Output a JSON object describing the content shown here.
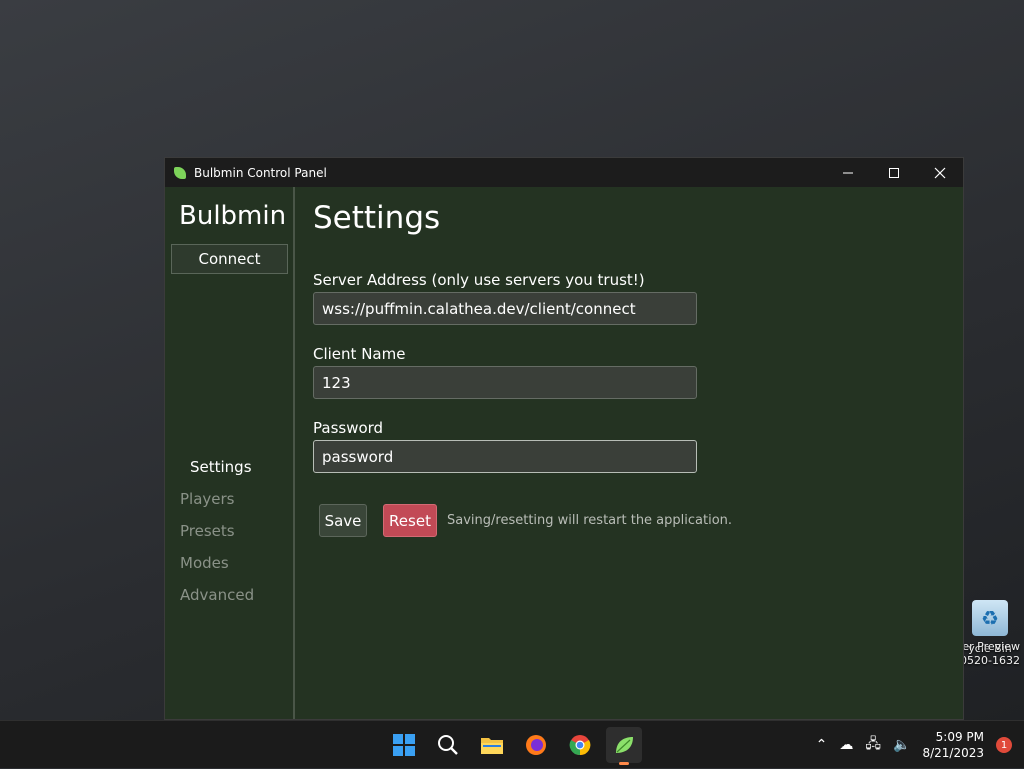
{
  "window": {
    "title": "Bulbmin Control Panel"
  },
  "sidebar": {
    "brand": "Bulbmin",
    "connect_label": "Connect",
    "nav": [
      {
        "label": "Settings",
        "active": true
      },
      {
        "label": "Players",
        "active": false
      },
      {
        "label": "Presets",
        "active": false
      },
      {
        "label": "Modes",
        "active": false
      },
      {
        "label": "Advanced",
        "active": false
      }
    ]
  },
  "main": {
    "title": "Settings",
    "server_address": {
      "label": "Server Address (only use servers you trust!)",
      "value": "wss://puffmin.calathea.dev/client/connect"
    },
    "client_name": {
      "label": "Client Name",
      "value": "123"
    },
    "password": {
      "label": "Password",
      "value": "password"
    },
    "save_label": "Save",
    "reset_label": "Reset",
    "note": "Saving/resetting will restart the application."
  },
  "desktop": {
    "recycle_bin_label": "ycle Bin",
    "watermark_line1": "er Preview",
    "watermark_line2": "30520-1632"
  },
  "taskbar": {
    "time": "5:09 PM",
    "date": "8/21/2023",
    "notification_count": "1"
  },
  "colors": {
    "accent": "#7dd35a",
    "reset": "#c24a56",
    "window_bg": "#243322"
  }
}
